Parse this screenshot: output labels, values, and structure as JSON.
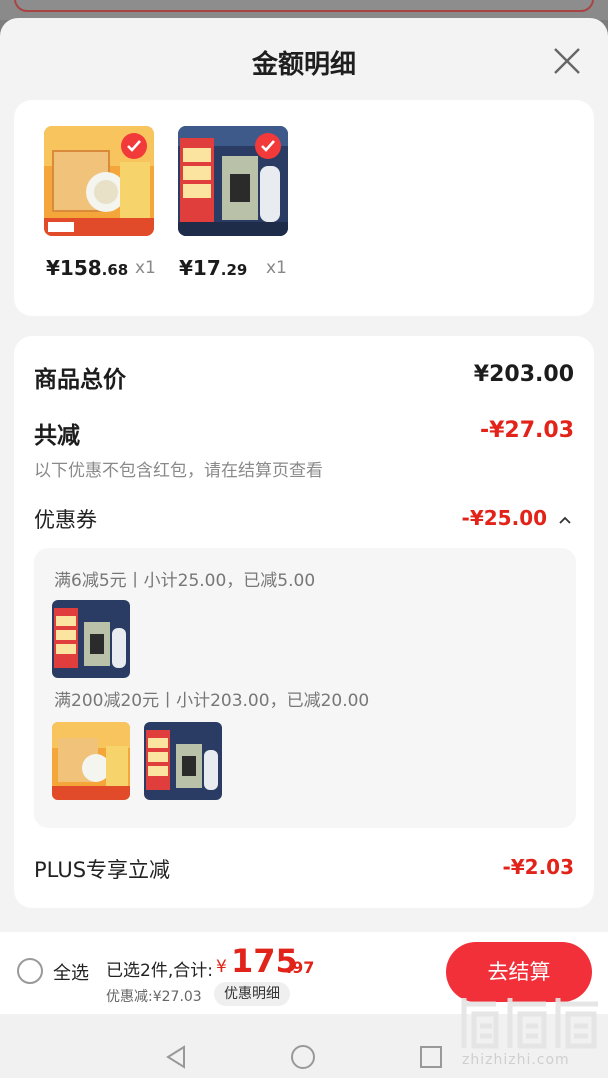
{
  "sheet": {
    "title": "金额明细"
  },
  "products": [
    {
      "price_int": "¥158",
      "price_dec": ".68",
      "qty": "x1"
    },
    {
      "price_int": "¥17",
      "price_dec": ".29",
      "qty": "x1"
    }
  ],
  "summary": {
    "total_label": "商品总价",
    "total_amount": "¥203.00",
    "discount_label": "共减",
    "discount_amount": "-¥27.03",
    "note": "以下优惠不包含红包，请在结算页查看",
    "coupon_label": "优惠券",
    "coupon_amount": "-¥25.00",
    "coupon_rules": [
      "满6减5元丨小计25.00，已减5.00",
      "满200减20元丨小计203.00，已减20.00"
    ],
    "plus_label": "PLUS专享立减",
    "plus_amount": "-¥2.03"
  },
  "bottom": {
    "select_all": "全选",
    "selected_text": "已选2件,合计:",
    "total_prefix": "¥",
    "total_int": "175",
    "total_dec": ".97",
    "discount_small": "优惠减:¥27.03",
    "detail_chip": "优惠明细",
    "checkout": "去结算"
  },
  "watermark": {
    "text": "zhizhizhi.com"
  },
  "colors": {
    "accent": "#e2231a",
    "button": "#f2303a"
  }
}
